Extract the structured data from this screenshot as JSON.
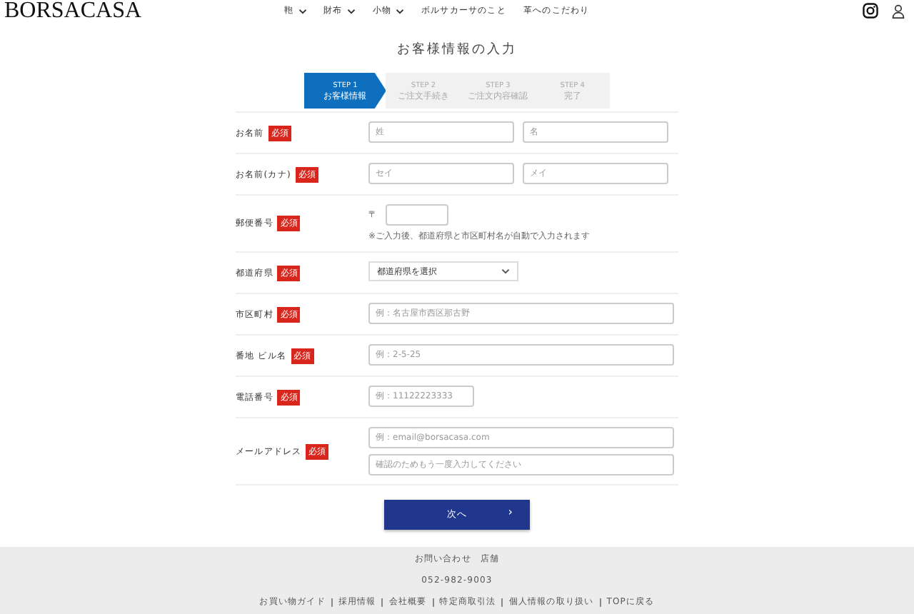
{
  "header": {
    "logo": "BORSACASA",
    "nav": [
      {
        "label": "鞄",
        "dropdown": true
      },
      {
        "label": "財布",
        "dropdown": true
      },
      {
        "label": "小物",
        "dropdown": true
      },
      {
        "label": "ボルサカーサのこと",
        "dropdown": false
      },
      {
        "label": "革へのこだわり",
        "dropdown": false
      }
    ]
  },
  "title": "お客様情報の入力",
  "steps": [
    {
      "step": "STEP 1",
      "label": "お客様情報",
      "selected": true
    },
    {
      "step": "STEP 2",
      "label": "ご注文手続き",
      "selected": false
    },
    {
      "step": "STEP 3",
      "label": "ご注文内容確認",
      "selected": false
    },
    {
      "step": "STEP 4",
      "label": "完了",
      "selected": false
    }
  ],
  "form_rows": [
    {
      "label": "お名前",
      "badge": "必須",
      "kind": "double",
      "placeholders": [
        "姓",
        "名"
      ]
    },
    {
      "label": "お名前(カナ)",
      "badge": "必須",
      "kind": "double",
      "placeholders": [
        "セイ",
        "メイ"
      ]
    },
    {
      "label": "郵便番号",
      "badge": "必須",
      "kind": "postal",
      "prefix": "〒",
      "note": "※ご入力後、都道府県と市区町村名が自動で入力されます"
    },
    {
      "label": "都道府県",
      "badge": "必須",
      "kind": "select",
      "value": "都道府県を選択"
    },
    {
      "label": "市区町村",
      "badge": "必須",
      "kind": "text",
      "placeholders": [
        "例：名古屋市西区那古野"
      ]
    },
    {
      "label": "番地 ビル名",
      "badge": "必須",
      "kind": "text",
      "placeholders": [
        "例：2-5-25"
      ]
    },
    {
      "label": "電話番号",
      "badge": "必須",
      "kind": "short",
      "placeholders": [
        "例：11122223333"
      ]
    },
    {
      "label": "メールアドレス",
      "badge": "必須",
      "kind": "email",
      "placeholders": [
        "例：email@borsacasa.com",
        "確認のためもう一度入力してください"
      ]
    }
  ],
  "next_button": {
    "label": "次へ",
    "arrow": "›"
  },
  "footer": {
    "links_top": "お問い合わせ　店舗",
    "phone": "052-982-9003",
    "links": [
      "お買い物ガイド",
      "採用情報",
      "会社概要",
      "特定商取引法",
      "個人情報の取り扱い",
      "TOPに戻る"
    ]
  }
}
